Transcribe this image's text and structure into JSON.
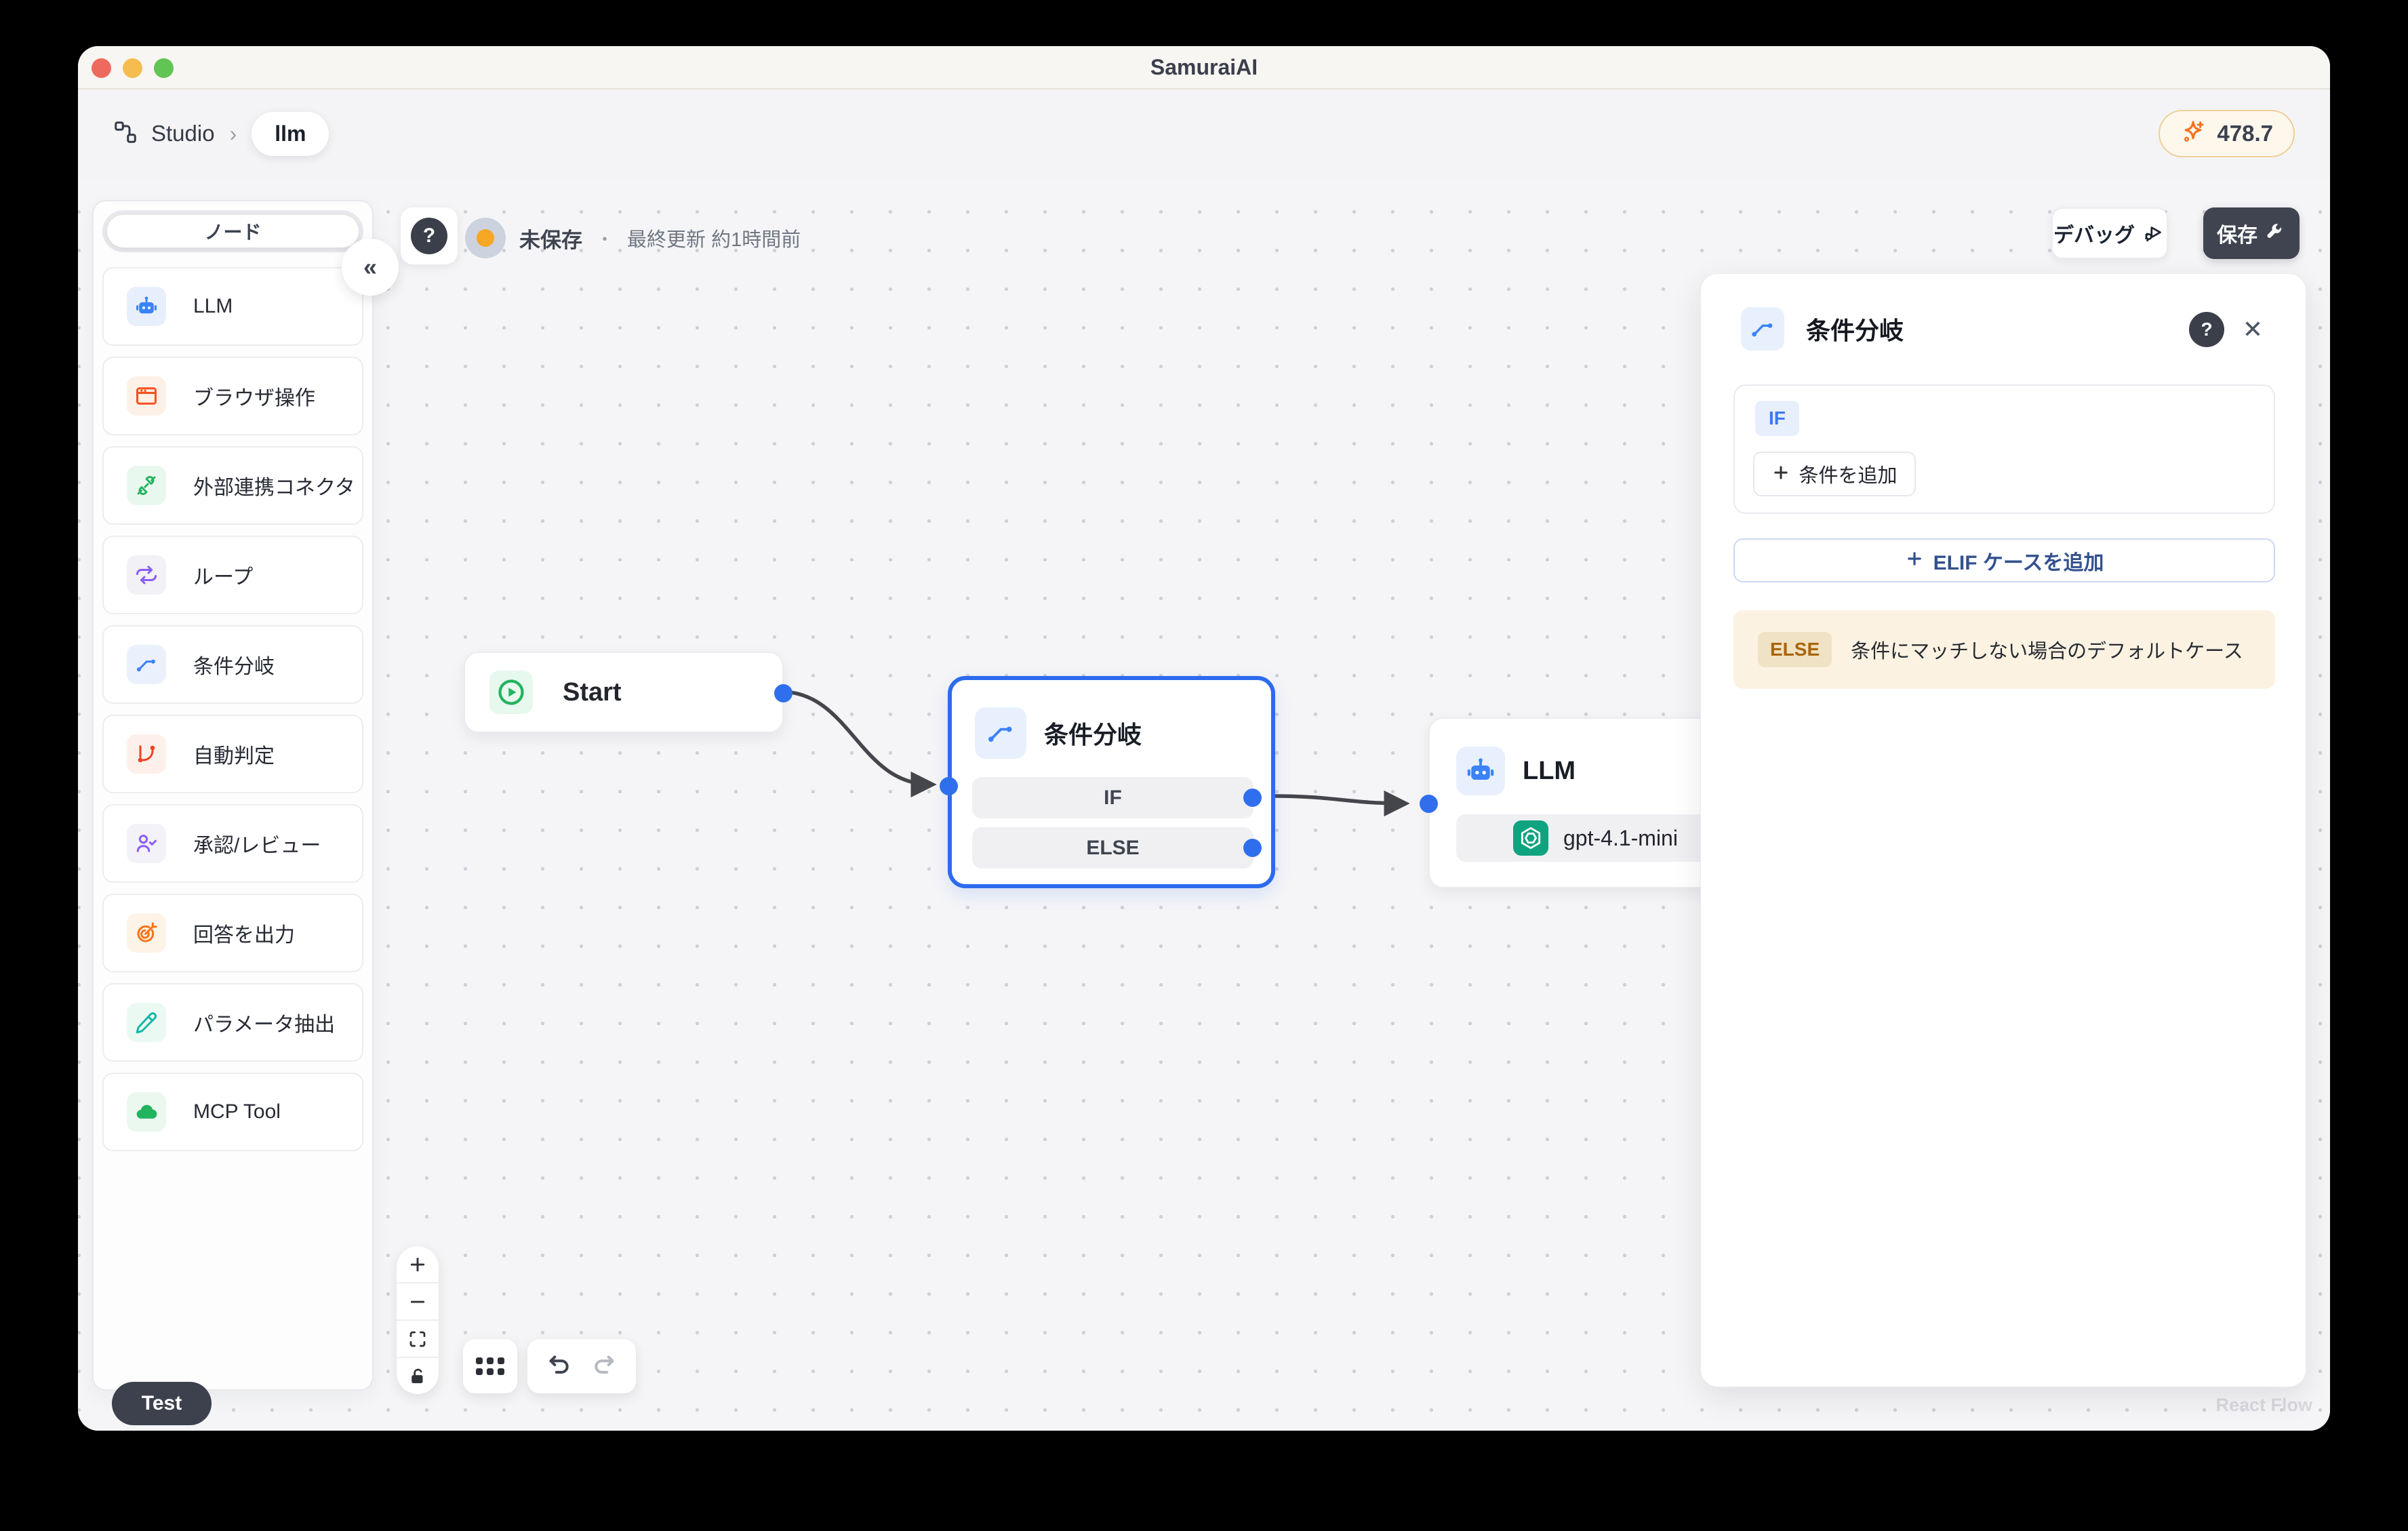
{
  "window": {
    "title": "SamuraiAI"
  },
  "breadcrumb": {
    "app": "Studio",
    "separator": "›",
    "current": "llm"
  },
  "credits": {
    "value": "478.7",
    "icon": "sparkles-icon",
    "accent_color": "#f4731c"
  },
  "sidebar": {
    "tab_label": "ノード",
    "collapse_glyph": "«",
    "items": [
      {
        "label": "LLM",
        "icon": "robot-icon",
        "color": "#3b82f6",
        "bg": "#e7effd"
      },
      {
        "label": "ブラウザ操作",
        "icon": "browser-icon",
        "color": "#f4511e",
        "bg": "#fdf1e7"
      },
      {
        "label": "外部連携コネクタ",
        "icon": "plug-icon",
        "color": "#22b35e",
        "bg": "#e9f8ee"
      },
      {
        "label": "ループ",
        "icon": "loop-icon",
        "color": "#8b5cf6",
        "bg": "#f1f1f6"
      },
      {
        "label": "条件分岐",
        "icon": "branch-icon",
        "color": "#3b82f6",
        "bg": "#ebf1fc"
      },
      {
        "label": "自動判定",
        "icon": "git-branch-icon",
        "color": "#ef4123",
        "bg": "#fdf0ea"
      },
      {
        "label": "承認/レビュー",
        "icon": "user-check-icon",
        "color": "#8b5cf6",
        "bg": "#f2f2f8"
      },
      {
        "label": "回答を出力",
        "icon": "target-icon",
        "color": "#f97316",
        "bg": "#fdf3e7"
      },
      {
        "label": "パラメータ抽出",
        "icon": "pen-icon",
        "color": "#14b8a6",
        "bg": "#ebf9f3"
      },
      {
        "label": "MCP Tool",
        "icon": "cloud-icon",
        "color": "#22b35e",
        "bg": "#eaf8ef"
      }
    ]
  },
  "toolbar": {
    "help_glyph": "?",
    "status_label": "未保存",
    "dot_separator": "・",
    "last_updated": "最終更新 約1時間前",
    "debug_label": "デバッグ",
    "save_label": "保存"
  },
  "canvas": {
    "nodes": {
      "start": {
        "title": "Start"
      },
      "branch": {
        "title": "条件分岐",
        "rows": [
          "IF",
          "ELSE"
        ]
      },
      "llm": {
        "title": "LLM",
        "model": "gpt-4.1-mini",
        "provider_icon": "openai-icon"
      }
    },
    "test_badge": "Test",
    "watermark": "React Flow"
  },
  "panel": {
    "title": "条件分岐",
    "help_glyph": "?",
    "close_glyph": "✕",
    "if_badge": "IF",
    "add_condition_label": "条件を追加",
    "add_elif_label": "ELIF ケースを追加",
    "else_badge": "ELSE",
    "else_description": "条件にマッチしない場合のデフォルトケース"
  },
  "colors": {
    "selection_blue": "#2c6bee",
    "handle_blue": "#2f6fed",
    "edge_gray": "#45464c",
    "credit_orange": "#f4731c",
    "status_orange": "#f6a723",
    "openai_green": "#10a37f",
    "save_button_bg": "#3f4450",
    "else_bg": "#fbf2e2"
  }
}
